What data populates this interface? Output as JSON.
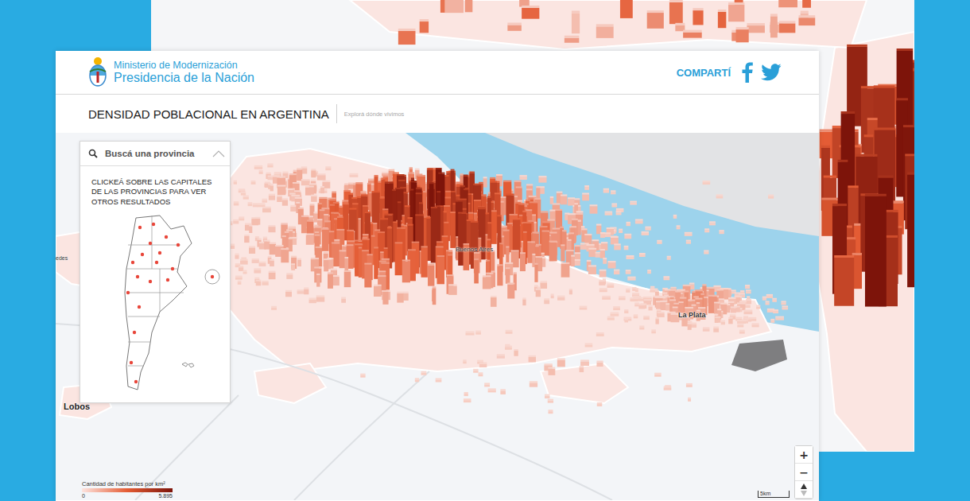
{
  "header": {
    "ministry": "Ministerio de Modernización",
    "presidency": "Presidencia de la Nación",
    "share_label": "COMPARTÍ"
  },
  "page": {
    "title": "DENSIDAD POBLACIONAL EN ARGENTINA",
    "subtitle": "Explorá dónde vivimos"
  },
  "panel": {
    "search_placeholder": "Buscá una provincia",
    "instructions": "CLICKEÁ SOBRE LAS CAPITALES DE LAS PROVINCIAS PARA VER OTROS RESULTADOS"
  },
  "map_labels": [
    {
      "text": "Buenos Aires"
    },
    {
      "text": "La Plata"
    },
    {
      "text": "Lobos"
    },
    {
      "text": "edes"
    }
  ],
  "legend": {
    "title": "Cantidad de habitantes por km²",
    "min": "0",
    "max": "5.895"
  },
  "zoom_controls": [
    "+",
    "−"
  ],
  "scale": "5km"
}
